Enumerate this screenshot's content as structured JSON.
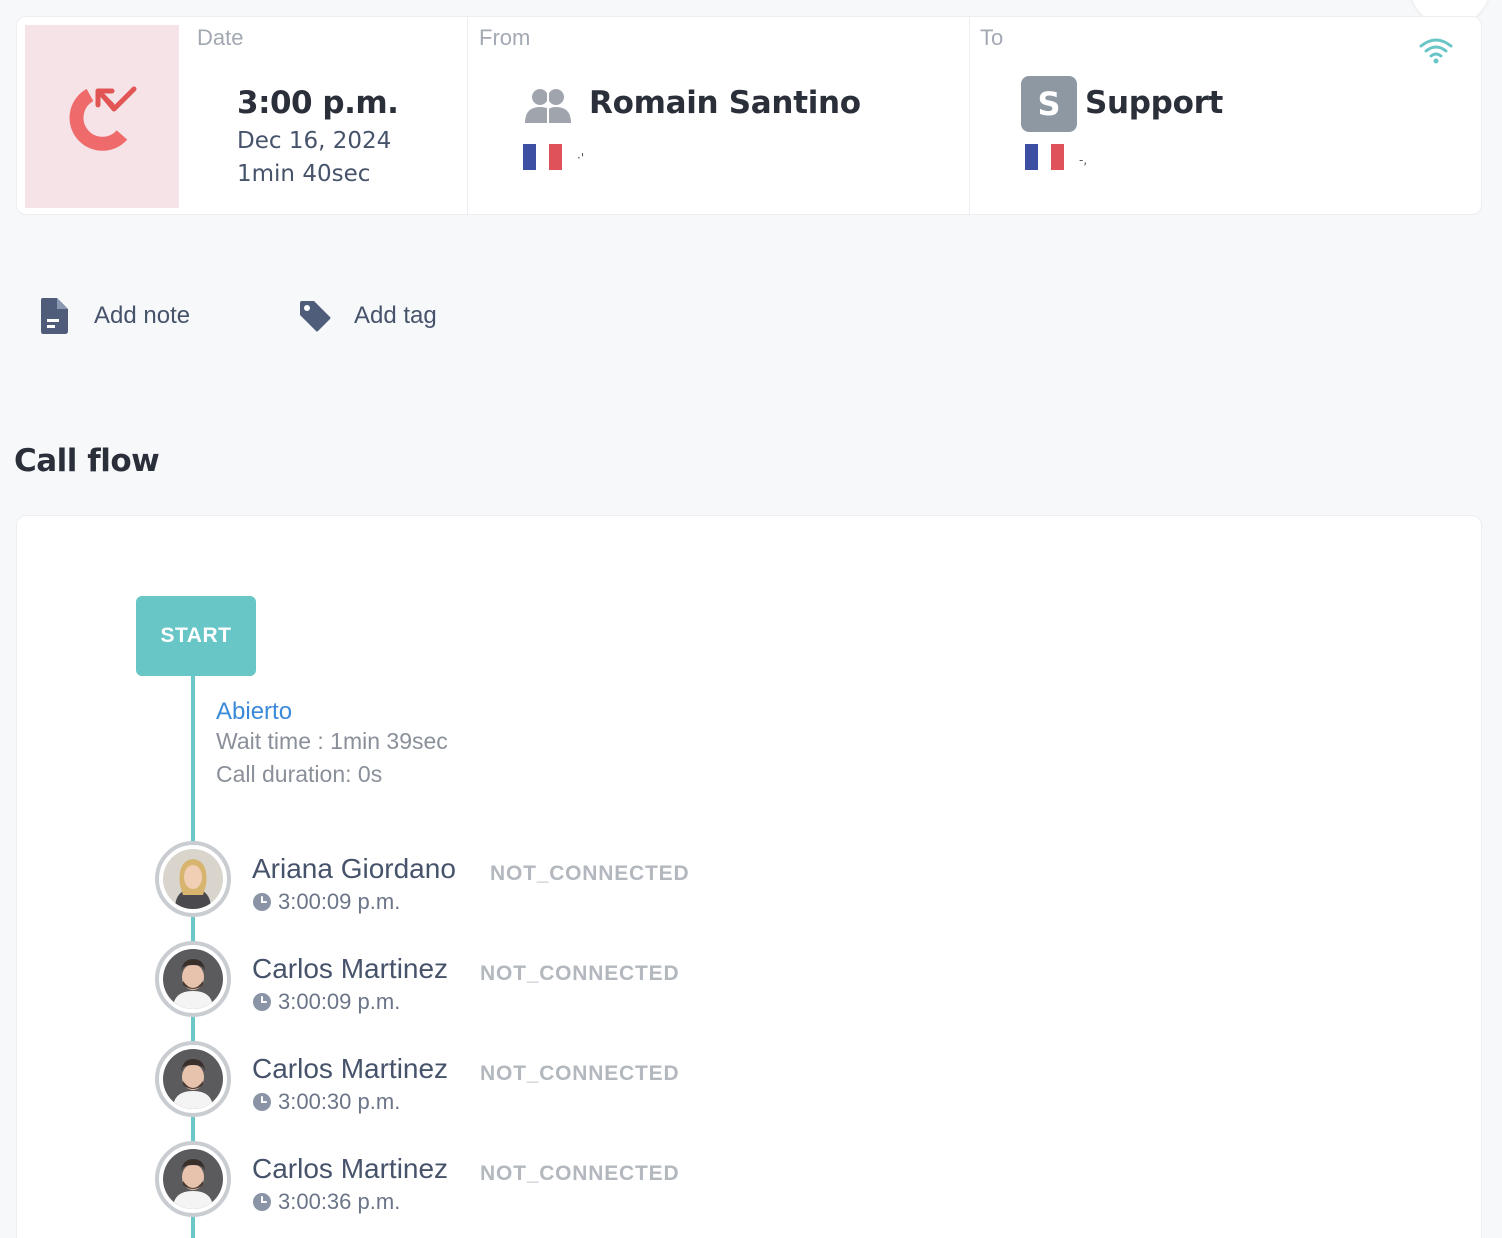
{
  "call": {
    "labels": {
      "date": "Date",
      "from": "From",
      "to": "To"
    },
    "time": "3:00 p.m.",
    "date": "Dec 16, 2024",
    "duration": "1min 40sec",
    "from": {
      "name": "Romain Santino",
      "country": "France",
      "number_glyph": "·'"
    },
    "to": {
      "name": "Support",
      "initial": "S",
      "country": "France",
      "number_glyph": "-,"
    },
    "call_type_icon": "missed-incoming-call-icon",
    "signal_icon": "wifi-icon",
    "colors": {
      "call_tile_bg": "#f5e3e8",
      "call_icon": "#ef6b6b",
      "accent_teal": "#69c6c6"
    }
  },
  "actions": {
    "add_note": "Add note",
    "add_tag": "Add tag"
  },
  "call_flow": {
    "title": "Call flow",
    "start_label": "START",
    "queue": {
      "name": "Abierto",
      "wait_time": "Wait time : 1min 39sec",
      "call_duration": "Call duration: 0s"
    },
    "attempts": [
      {
        "name": "Ariana Giordano",
        "status": "NOT_CONNECTED",
        "time": "3:00:09 p.m."
      },
      {
        "name": "Carlos Martinez",
        "status": "NOT_CONNECTED",
        "time": "3:00:09 p.m."
      },
      {
        "name": "Carlos Martinez",
        "status": "NOT_CONNECTED",
        "time": "3:00:30 p.m."
      },
      {
        "name": "Carlos Martinez",
        "status": "NOT_CONNECTED",
        "time": "3:00:36 p.m."
      }
    ]
  }
}
